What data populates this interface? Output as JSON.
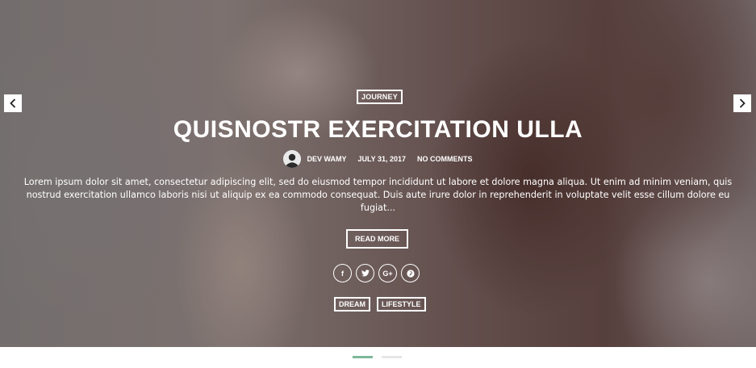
{
  "slide": {
    "category": "JOURNEY",
    "title": "QUISNOSTR EXERCITATION ULLA",
    "author": "DEV WAMY",
    "date": "JULY 31, 2017",
    "comments": "NO COMMENTS",
    "excerpt": "Lorem ipsum dolor sit amet, consectetur adipiscing elit, sed do eiusmod tempor incididunt ut labore et dolore magna aliqua. Ut enim ad minim veniam, quis nostrud exercitation ullamco laboris nisi ut aliquip ex ea commodo consequat. Duis aute irure dolor in reprehenderit in voluptate velit esse cillum dolore eu fugiat...",
    "read_more": "READ MORE",
    "share_icons": [
      "facebook-icon",
      "twitter-icon",
      "google-plus-icon",
      "pinterest-icon"
    ],
    "tags": [
      "DREAM",
      "LIFESTYLE"
    ]
  },
  "share_glyphs": {
    "facebook": "f",
    "google_plus": "G+"
  },
  "pager": {
    "count": 2,
    "active_index": 0,
    "active_color": "#7cb89a",
    "inactive_color": "#e6e6e6"
  }
}
